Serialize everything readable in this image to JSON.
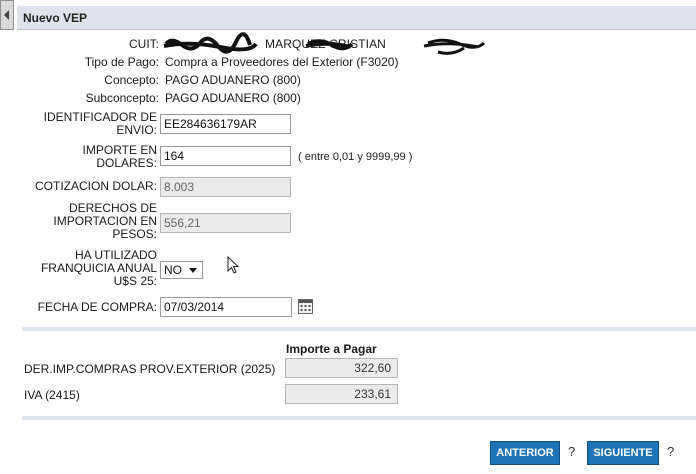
{
  "header": {
    "title": "Nuevo VEP"
  },
  "info": {
    "cuit_label": "CUIT:",
    "cuit_value": "MARQUEZ CRISTIAN",
    "tipo_label": "Tipo de Pago:",
    "tipo_value": "Compra a Proveedores del Exterior (F3020)",
    "concepto_label": "Concepto:",
    "concepto_value": "PAGO ADUANERO (800)",
    "subconcepto_label": "Subconcepto:",
    "subconcepto_value": "PAGO ADUANERO (800)"
  },
  "form": {
    "identificador_label_1": "IDENTIFICADOR DE",
    "identificador_label_2": "ENVIO:",
    "identificador_value": "EE284636179AR",
    "importe_label_1": "IMPORTE EN",
    "importe_label_2": "DOLARES:",
    "importe_value": "164",
    "importe_hint": "( entre 0,01 y 9999,99 )",
    "cotizacion_label": "COTIZACION DOLAR:",
    "cotizacion_value": "8.003",
    "derechos_label_1": "DERECHOS DE",
    "derechos_label_2": "IMPORTACION EN",
    "derechos_label_3": "PESOS:",
    "derechos_value": "556,21",
    "franquicia_label_1": "HA UTILIZADO",
    "franquicia_label_2": "FRANQUICIA ANUAL",
    "franquicia_label_3": "U$S 25:",
    "franquicia_value": "NO",
    "fecha_label": "FECHA DE COMPRA:",
    "fecha_value": "07/03/2014"
  },
  "totals": {
    "header": "Importe a Pagar",
    "rows": [
      {
        "label": "DER.IMP.COMPRAS PROV.EXTERIOR (2025)",
        "value": "322,60"
      },
      {
        "label": "IVA (2415)",
        "value": "233,61"
      }
    ]
  },
  "actions": {
    "anterior": "ANTERIOR",
    "siguiente": "SIGUIENTE",
    "help": "?"
  }
}
